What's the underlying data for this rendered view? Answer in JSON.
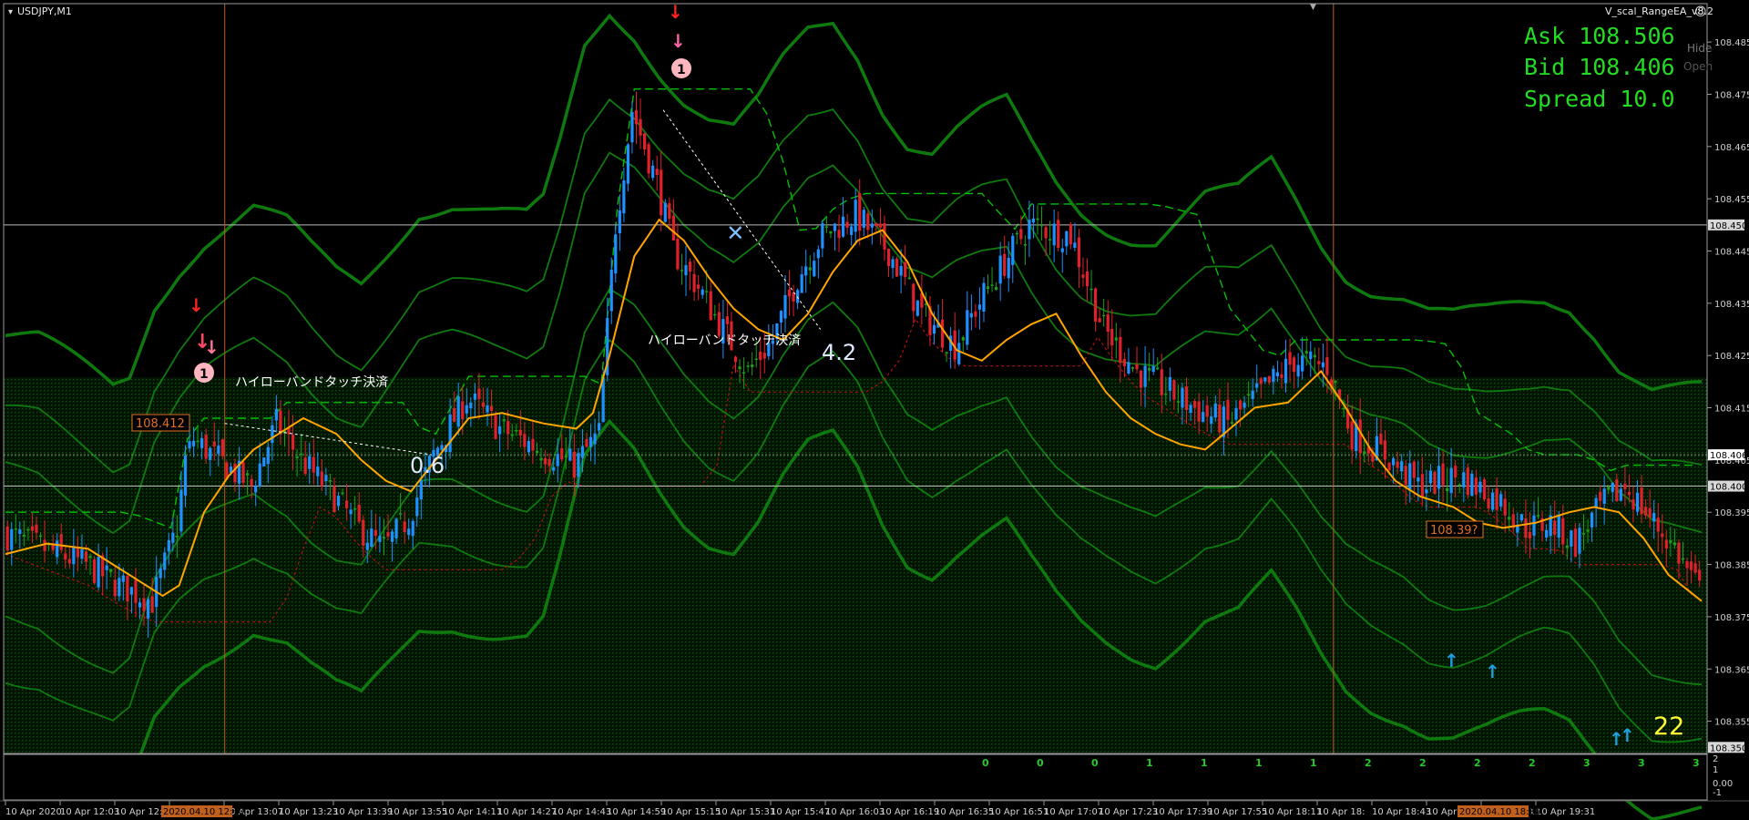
{
  "window": {
    "title": "USDJPY,M1",
    "ea_label": "V_scal_RangeEA_v8.2"
  },
  "side_buttons": [
    "Hide",
    "Open"
  ],
  "info": {
    "ask": "Ask 108.506",
    "bid": "Bid 108.406",
    "spread": "Spread 10.0"
  },
  "colors": {
    "background": "#000000",
    "bull_candle": "#1e90ff",
    "bear_candle": "#e0202a",
    "doji_candle": "#1aa01a",
    "bands": "#0e7a0e",
    "ma": "#ffa500",
    "dashed_level": "#00c000",
    "info_text": "#22dd22",
    "axis_text": "#d0d0d0",
    "count_text": "#22cc22",
    "price_tag": "#e07020"
  },
  "annotations": {
    "close1": "ハイローバンドタッチ決済",
    "close2": "ハイローバンドタッチ決済",
    "pips1": "0.6",
    "pips2": "4.2",
    "entry1_price": "108.412",
    "entry2_price": "108.39?",
    "big_count": "22",
    "order_num": "1"
  },
  "chart_data": {
    "type": "candlestick",
    "symbol": "USDJPY",
    "timeframe": "M1",
    "ylim": [
      108.349,
      108.492
    ],
    "y_ticks": [
      "108.485",
      "108.475",
      "108.465",
      "108.455",
      "108.445",
      "108.435",
      "108.425",
      "108.415",
      "108.405",
      "108.395",
      "108.385",
      "108.375",
      "108.365",
      "108.355"
    ],
    "price_labels": [
      "108.450",
      "108.406",
      "108.400",
      "108.350"
    ],
    "horizontal_lines": [
      108.45,
      108.4
    ],
    "x_labels": [
      "10 Apr 2020",
      "10 Apr 12:03",
      "10 Apr 12:",
      "10 Apr 12:51",
      "10 Apr 13:07",
      "10 Apr 13:23",
      "10 Apr 13:39",
      "10 Apr 13:55",
      "10 Apr 14:11",
      "10 Apr 14:27",
      "10 Apr 14:43",
      "10 Apr 14:59",
      "10 Apr 15:15",
      "10 Apr 15:31",
      "10 Apr 15:47",
      "10 Apr 16:03",
      "10 Apr 16:19",
      "10 Apr 16:35",
      "10 Apr 16:51",
      "10 Apr 17:07",
      "10 Apr 17:23",
      "10 Apr 17:39",
      "10 Apr 17:55",
      "10 Apr 18:11",
      "10 Apr 18:",
      "10 Apr 18:43",
      "10 Apr 18:59",
      "10 Apr 19:15",
      "10 Apr 19:31"
    ],
    "x_markers": [
      "2020.04.10 12:40",
      "2020.04.10 18:35"
    ],
    "indicator_counts": [
      "0",
      "0",
      "0",
      "1",
      "1",
      "1",
      "1",
      "2",
      "2",
      "2",
      "2",
      "3",
      "3",
      "3"
    ],
    "lower_axis": [
      "2",
      "1",
      "0.00",
      "-1"
    ],
    "close_path": [
      [
        0,
        108.391
      ],
      [
        10,
        108.388
      ],
      [
        20,
        108.385
      ],
      [
        28,
        108.381
      ],
      [
        36,
        108.378
      ],
      [
        42,
        108.392
      ],
      [
        44,
        108.405
      ],
      [
        46,
        108.409
      ],
      [
        52,
        108.405
      ],
      [
        60,
        108.4
      ],
      [
        66,
        108.412
      ],
      [
        72,
        108.405
      ],
      [
        80,
        108.398
      ],
      [
        86,
        108.392
      ],
      [
        92,
        108.388
      ],
      [
        98,
        108.394
      ],
      [
        104,
        108.406
      ],
      [
        112,
        108.417
      ],
      [
        120,
        108.411
      ],
      [
        130,
        108.407
      ],
      [
        138,
        108.404
      ],
      [
        144,
        108.41
      ],
      [
        146,
        108.43
      ],
      [
        148,
        108.45
      ],
      [
        152,
        108.472
      ],
      [
        158,
        108.458
      ],
      [
        162,
        108.445
      ],
      [
        168,
        108.438
      ],
      [
        174,
        108.43
      ],
      [
        180,
        108.422
      ],
      [
        186,
        108.428
      ],
      [
        192,
        108.44
      ],
      [
        198,
        108.448
      ],
      [
        206,
        108.452
      ],
      [
        214,
        108.445
      ],
      [
        222,
        108.433
      ],
      [
        230,
        108.427
      ],
      [
        238,
        108.438
      ],
      [
        248,
        108.45
      ],
      [
        258,
        108.448
      ],
      [
        266,
        108.43
      ],
      [
        274,
        108.422
      ],
      [
        282,
        108.418
      ],
      [
        290,
        108.414
      ],
      [
        296,
        108.412
      ],
      [
        304,
        108.418
      ],
      [
        312,
        108.424
      ],
      [
        320,
        108.423
      ],
      [
        326,
        108.41
      ],
      [
        334,
        108.406
      ],
      [
        342,
        108.4
      ],
      [
        352,
        108.402
      ],
      [
        362,
        108.397
      ],
      [
        368,
        108.392
      ],
      [
        374,
        108.393
      ],
      [
        380,
        108.389
      ],
      [
        386,
        108.396
      ],
      [
        392,
        108.4
      ],
      [
        398,
        108.394
      ],
      [
        404,
        108.388
      ],
      [
        410,
        108.38
      ]
    ],
    "ma_path": [
      [
        0,
        108.387
      ],
      [
        10,
        108.389
      ],
      [
        20,
        108.388
      ],
      [
        30,
        108.383
      ],
      [
        38,
        108.379
      ],
      [
        42,
        108.381
      ],
      [
        48,
        108.395
      ],
      [
        54,
        108.402
      ],
      [
        60,
        108.407
      ],
      [
        66,
        108.41
      ],
      [
        72,
        108.413
      ],
      [
        80,
        108.41
      ],
      [
        86,
        108.405
      ],
      [
        92,
        108.401
      ],
      [
        98,
        108.399
      ],
      [
        104,
        108.405
      ],
      [
        112,
        108.413
      ],
      [
        120,
        108.414
      ],
      [
        130,
        108.412
      ],
      [
        138,
        108.411
      ],
      [
        142,
        108.414
      ],
      [
        146,
        108.425
      ],
      [
        152,
        108.444
      ],
      [
        158,
        108.451
      ],
      [
        164,
        108.447
      ],
      [
        170,
        108.44
      ],
      [
        176,
        108.434
      ],
      [
        182,
        108.43
      ],
      [
        188,
        108.428
      ],
      [
        194,
        108.433
      ],
      [
        200,
        108.441
      ],
      [
        206,
        108.447
      ],
      [
        212,
        108.449
      ],
      [
        218,
        108.443
      ],
      [
        224,
        108.433
      ],
      [
        230,
        108.426
      ],
      [
        236,
        108.424
      ],
      [
        242,
        108.428
      ],
      [
        248,
        108.431
      ],
      [
        254,
        108.433
      ],
      [
        260,
        108.425
      ],
      [
        266,
        108.418
      ],
      [
        272,
        108.413
      ],
      [
        278,
        108.41
      ],
      [
        284,
        108.408
      ],
      [
        290,
        108.407
      ],
      [
        296,
        108.411
      ],
      [
        302,
        108.415
      ],
      [
        310,
        108.416
      ],
      [
        318,
        108.422
      ],
      [
        324,
        108.415
      ],
      [
        330,
        108.407
      ],
      [
        336,
        108.401
      ],
      [
        342,
        108.398
      ],
      [
        350,
        108.396
      ],
      [
        356,
        108.393
      ],
      [
        362,
        108.392
      ],
      [
        370,
        108.393
      ],
      [
        378,
        108.395
      ],
      [
        384,
        108.396
      ],
      [
        390,
        108.395
      ],
      [
        396,
        108.39
      ],
      [
        402,
        108.383
      ],
      [
        410,
        108.378
      ]
    ]
  }
}
